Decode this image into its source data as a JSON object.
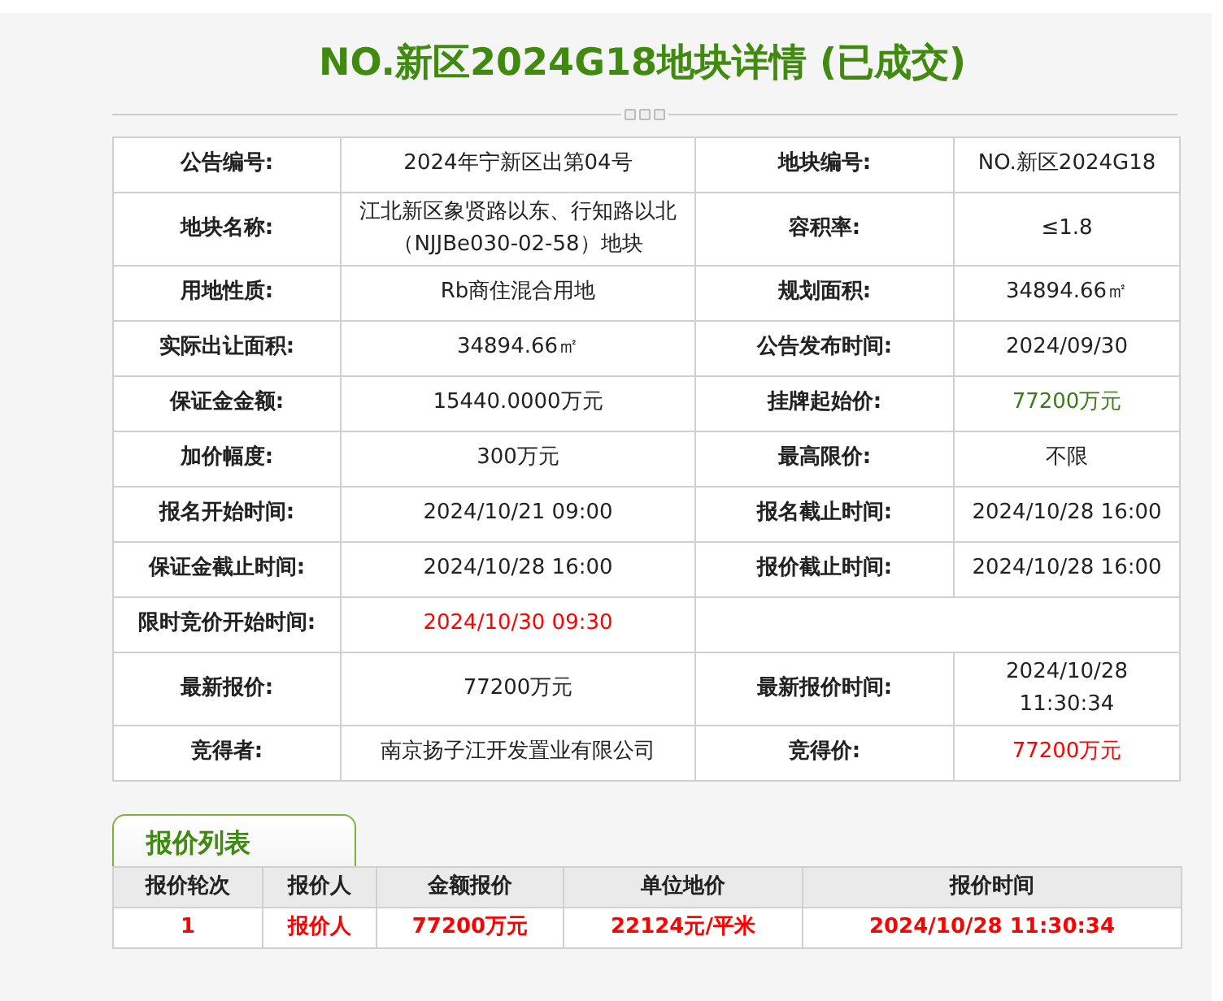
{
  "title": "NO.新区2024G18地块详情 (已成交)",
  "details": [
    {
      "pairs": [
        {
          "label": "公告编号:",
          "value": "2024年宁新区出第04号"
        },
        {
          "label": "地块编号:",
          "value": "NO.新区2024G18"
        }
      ]
    },
    {
      "pairs": [
        {
          "label": "地块名称:",
          "value": "江北新区象贤路以东、行知路以北（NJJBe030-02-58）地块"
        },
        {
          "label": "容积率:",
          "value": "≤1.8"
        }
      ]
    },
    {
      "pairs": [
        {
          "label": "用地性质:",
          "value": "Rb商住混合用地"
        },
        {
          "label": "规划面积:",
          "value": "34894.66㎡"
        }
      ]
    },
    {
      "pairs": [
        {
          "label": "实际出让面积:",
          "value": "34894.66㎡"
        },
        {
          "label": "公告发布时间:",
          "value": "2024/09/30"
        }
      ]
    },
    {
      "pairs": [
        {
          "label": "保证金金额:",
          "value": "15440.0000万元"
        },
        {
          "label": "挂牌起始价:",
          "value": "77200万元",
          "color": "#3a7a1a"
        }
      ]
    },
    {
      "pairs": [
        {
          "label": "加价幅度:",
          "value": "300万元"
        },
        {
          "label": "最高限价:",
          "value": "不限"
        }
      ]
    },
    {
      "pairs": [
        {
          "label": "报名开始时间:",
          "value": "2024/10/21 09:00"
        },
        {
          "label": "报名截止时间:",
          "value": "2024/10/28 16:00"
        }
      ]
    },
    {
      "pairs": [
        {
          "label": "保证金截止时间:",
          "value": "2024/10/28 16:00"
        },
        {
          "label": "报价截止时间:",
          "value": "2024/10/28 16:00"
        }
      ]
    },
    {
      "pairs": [
        {
          "label": "限时竞价开始时间:",
          "value": "2024/10/30 09:30",
          "color": "#ff0000"
        }
      ]
    },
    {
      "pairs": [
        {
          "label": "最新报价:",
          "value": "77200万元"
        },
        {
          "label": "最新报价时间:",
          "value": "2024/10/28 11:30:34"
        }
      ]
    },
    {
      "pairs": [
        {
          "label": "竞得者:",
          "value": "南京扬子江开发置业有限公司"
        },
        {
          "label": "竞得价:",
          "value": "77200万元",
          "color": "#ff0000"
        }
      ]
    }
  ],
  "bids": {
    "tab": "报价列表",
    "columns": [
      "报价轮次",
      "报价人",
      "金额报价",
      "单位地价",
      "报价时间"
    ],
    "rows": [
      [
        "1",
        "报价人",
        "77200万元",
        "22124元/平米",
        "2024/10/28 11:30:34"
      ]
    ]
  }
}
